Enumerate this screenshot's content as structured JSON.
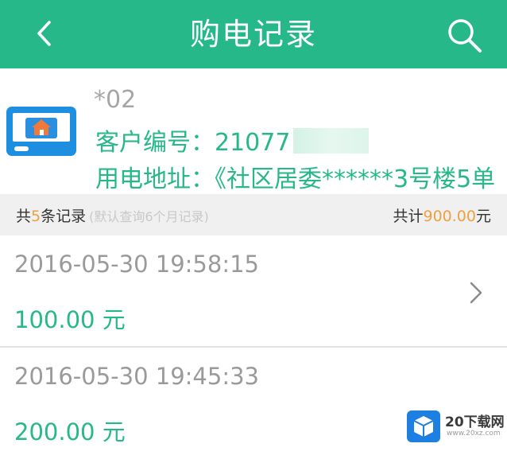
{
  "header": {
    "title": "购电记录",
    "back_icon": "chevron-left-icon",
    "search_icon": "search-icon",
    "background": "#27b889"
  },
  "account": {
    "icon": "meter-icon",
    "name": "*02",
    "customer_number": "客户编号：21077",
    "address": "用电地址：《社区居委******3号楼5单"
  },
  "summary": {
    "prefix": "共",
    "count": "5",
    "suffix": "条记录",
    "hint": "(默认查询6个月记录)",
    "total_label": "共计",
    "total_amount": "900.00",
    "total_unit": "元"
  },
  "records": [
    {
      "time": "2016-05-30 19:58:15",
      "amount": "100.00 元"
    },
    {
      "time": "2016-05-30 19:45:33",
      "amount": "200.00 元"
    }
  ],
  "watermark": {
    "name": "20下载网",
    "url": "www.20xz.com"
  },
  "colors": {
    "accent": "#27b889",
    "highlight": "#f0a040",
    "muted_text": "#9a9a9a"
  }
}
